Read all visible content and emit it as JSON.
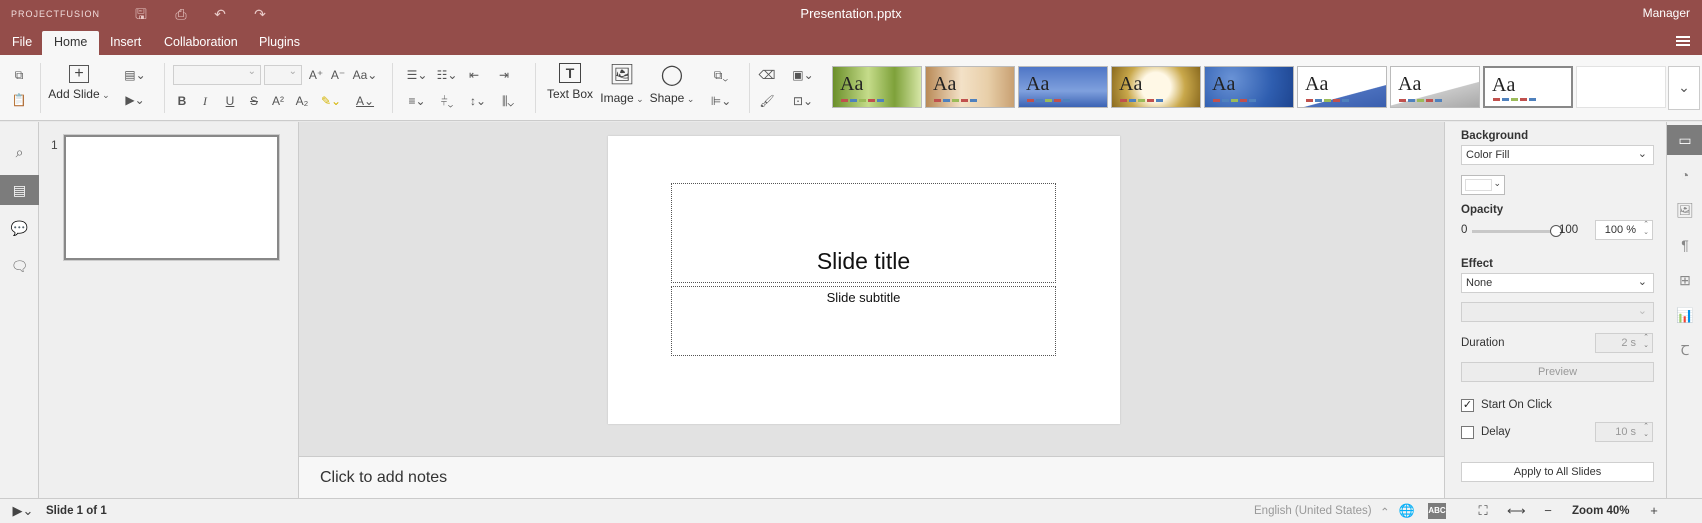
{
  "app": {
    "logo": "PROJECTFUSION",
    "document_title": "Presentation.pptx",
    "user": "Manager"
  },
  "tabs": [
    {
      "label": "File"
    },
    {
      "label": "Home"
    },
    {
      "label": "Insert"
    },
    {
      "label": "Collaboration"
    },
    {
      "label": "Plugins"
    }
  ],
  "toolbar": {
    "add_slide": "Add Slide",
    "text_box": "Text Box",
    "image": "Image",
    "shape": "Shape"
  },
  "themes": [
    {
      "label": "Aa",
      "bg": "linear-gradient(90deg,#6b8f2a,#c5dc8a 40%,#7ea13a 70%,#d6e6a6)"
    },
    {
      "label": "Aa",
      "bg": "linear-gradient(90deg,#b98a57,#f3e1c7 40%,#e8cfa9 70%,#c8a072)"
    },
    {
      "label": "Aa",
      "bg": "linear-gradient(180deg,#4f76c6,#7fa0dd 60%,#3c63b4)"
    },
    {
      "label": "Aa",
      "bg": "radial-gradient(circle at 50% 50%,#fff8e6 30%,#c9a84b 60%,#8a6a1f)"
    },
    {
      "label": "Aa",
      "bg": "radial-gradient(circle at 30% 30%,#6a93d6,#2f5eb0 60%,#1e4590)"
    },
    {
      "label": "Aa",
      "bg": "linear-gradient(165deg,#ffffff 65%,#4a6fbd 66%,#3a5fae)"
    },
    {
      "label": "Aa",
      "bg": "linear-gradient(165deg,#ffffff 60%,#c8c8c8 61%,#a8a8a8)"
    },
    {
      "label": "Aa",
      "bg": "#ffffff"
    }
  ],
  "slides_panel": {
    "slide_number": "1"
  },
  "slide": {
    "title": "Slide title",
    "subtitle": "Slide subtitle"
  },
  "notes": {
    "placeholder": "Click to add notes"
  },
  "right_panel": {
    "background_label": "Background",
    "background_value": "Color Fill",
    "opacity_label": "Opacity",
    "opacity_min": "0",
    "opacity_max": "100",
    "opacity_value": "100 %",
    "opacity_level": 100,
    "effect_label": "Effect",
    "effect_value": "None",
    "duration_label": "Duration",
    "duration_value": "2 s",
    "preview_label": "Preview",
    "start_on_click_label": "Start On Click",
    "start_on_click_checked": true,
    "delay_label": "Delay",
    "delay_checked": false,
    "delay_value": "10 s",
    "apply_all_label": "Apply to All Slides"
  },
  "status": {
    "slide_count": "Slide 1 of 1",
    "language": "English (United States)",
    "zoom": "Zoom 40%"
  },
  "colors": {
    "brand": "#944d4a",
    "active_rail": "#7c7c7c"
  }
}
